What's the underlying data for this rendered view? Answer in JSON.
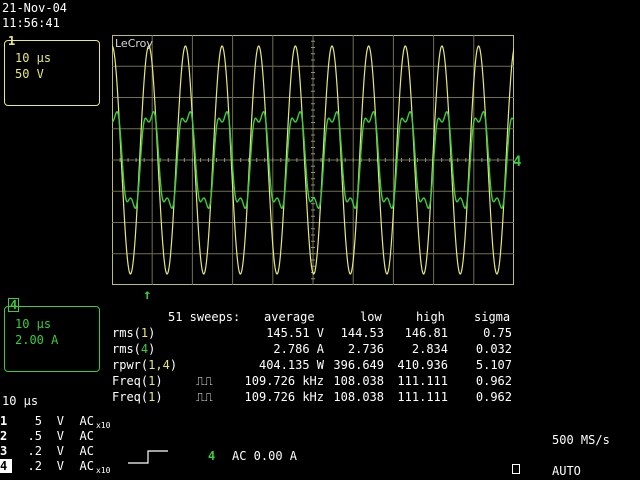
{
  "header": {
    "date": "21-Nov-04",
    "time": "11:56:41"
  },
  "trace1": {
    "tag": "1",
    "timebase": "10 µs",
    "vdiv": "50 V",
    "color": "#e8e87a"
  },
  "trace4": {
    "tag": "4",
    "timebase": "10 µs",
    "vdiv": "2.00 A",
    "color": "#3ccc3c"
  },
  "scope": {
    "brand": "LeCroy",
    "right_marker": "4",
    "trigger_marker": "↑"
  },
  "measurements": {
    "sweeps_label": "51 sweeps:",
    "columns": [
      "average",
      "low",
      "high",
      "sigma"
    ],
    "rows": [
      {
        "name": "rms(",
        "ch": "1",
        "chc": "y",
        "end": ")",
        "pulse": "",
        "avg": "145.51 V",
        "low": "144.53",
        "high": "146.81",
        "sigma": "0.75"
      },
      {
        "name": "rms(",
        "ch": "4",
        "chc": "g",
        "end": ")",
        "pulse": "",
        "avg": "2.786 A",
        "low": "2.736",
        "high": "2.834",
        "sigma": "0.032"
      },
      {
        "name": "rpwr(",
        "ch": "1,4",
        "chc": "y",
        "end": ")",
        "pulse": "",
        "avg": "404.135 W",
        "low": "396.649",
        "high": "410.936",
        "sigma": "5.107"
      },
      {
        "name": "Freq(",
        "ch": "1",
        "chc": "y",
        "end": ")",
        "pulse": "⎍⎍",
        "avg": "109.726 kHz",
        "low": "108.038",
        "high": "111.111",
        "sigma": "0.962"
      },
      {
        "name": "Freq(",
        "ch": "1",
        "chc": "y",
        "end": ")",
        "pulse": "⎍⎍",
        "avg": "109.726 kHz",
        "low": "108.038",
        "high": "111.111",
        "sigma": "0.962"
      }
    ]
  },
  "timebase_readout": "10 µs",
  "channels": [
    {
      "n": "1",
      "volts": "5",
      "unit": "V",
      "coupling": "AC",
      "probe": "x10"
    },
    {
      "n": "2",
      "volts": ".5",
      "unit": "V",
      "coupling": "AC",
      "probe": ""
    },
    {
      "n": "3",
      "volts": ".2",
      "unit": "V",
      "coupling": "AC",
      "probe": ""
    },
    {
      "n": "4",
      "volts": ".2",
      "unit": "V",
      "coupling": "AC",
      "probe": "x10"
    }
  ],
  "trigger": {
    "channel": "4",
    "mode": "AC 0.00 A"
  },
  "sample_rate": "500 MS/s",
  "trigger_mode": "AUTO"
}
